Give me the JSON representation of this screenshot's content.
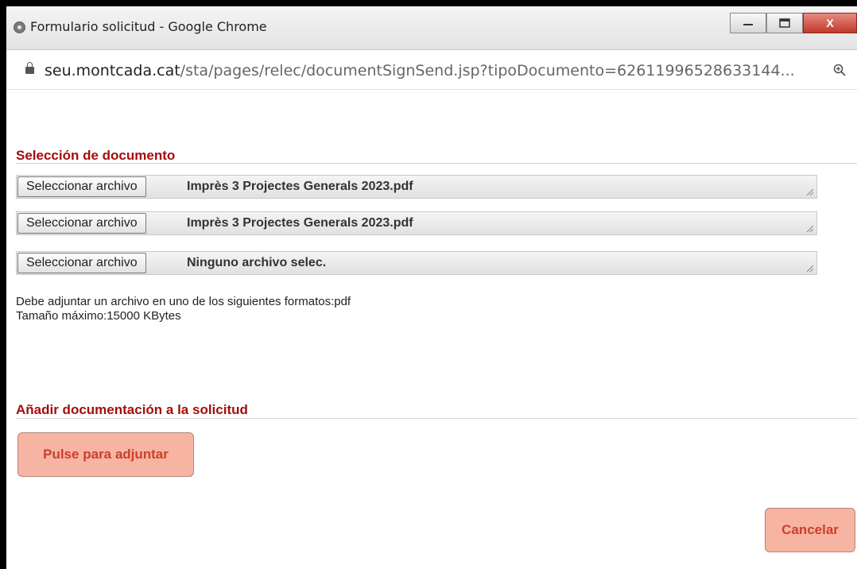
{
  "window": {
    "title": "Formulario solicitud - Google Chrome",
    "controls": {
      "minimize": "—",
      "maximize": "☐",
      "close": "X"
    }
  },
  "address": {
    "host": "seu.montcada.cat",
    "path": "/sta/pages/relec/documentSignSend.jsp?tipoDocumento=62611996528633144..."
  },
  "section_select": {
    "title": "Selección de documento",
    "rows": [
      {
        "button": "Seleccionar archivo",
        "filename": "Imprès 3 Projectes Generals 2023.pdf"
      },
      {
        "button": "Seleccionar archivo",
        "filename": "Imprès 3 Projectes Generals 2023.pdf"
      },
      {
        "button": "Seleccionar archivo",
        "filename": "Ninguno archivo selec."
      }
    ],
    "info_format": "Debe adjuntar un archivo en uno de los siguientes formatos:pdf",
    "info_size": "Tamaño máximo:15000 KBytes"
  },
  "section_attach": {
    "title": "Añadir documentación a la solicitud",
    "button": "Pulse para adjuntar"
  },
  "cancel_label": "Cancelar"
}
